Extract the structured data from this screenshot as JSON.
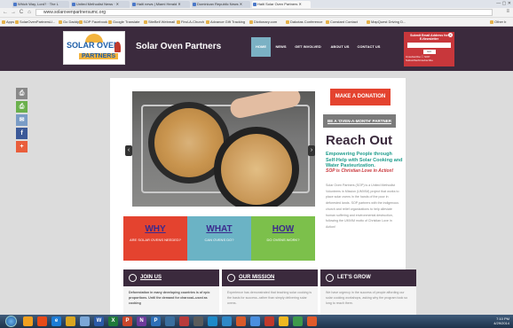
{
  "browser": {
    "tabs": [
      {
        "label": "Which Way, Lord? · The L"
      },
      {
        "label": "United Methodist News · ✕"
      },
      {
        "label": "Haiti news | Miami Herald ✕"
      },
      {
        "label": "Dominican Republic News ✕"
      },
      {
        "label": "Haiti Solar Oven Partners ✕"
      }
    ],
    "url": "www.solarovenpartnersumc.org",
    "bookmarks": [
      "Apps",
      "SolarOvenPartnersU...",
      "Go Daddy",
      "SOP Facebook",
      "Google Translate",
      "SiteBell Webmail",
      "Find-A-Church",
      "Advance Gift Tracking",
      "Dictionary.com",
      "Dakotas Conference",
      "Constant Contact",
      "MapQuest Driving D...",
      "Other b"
    ]
  },
  "site": {
    "logo": {
      "line1": "SOLAR OVEN",
      "line2": "PARTNERS"
    },
    "title": "Solar Oven Partners",
    "nav": [
      "HOME",
      "NEWS",
      "GET INVOLVED",
      "ABOUT US",
      "CONTACT US"
    ],
    "signup": {
      "line1": "Submit Email Address for",
      "line2": "E-Newsletter",
      "button": "GO",
      "sub": "Unsubscribe ☐  SOP Subscribe/Unsubscribe"
    }
  },
  "social": [
    "⎙",
    "⎙",
    "✉",
    "f",
    "+"
  ],
  "sidebar": {
    "donate": "MAKE A DONATION",
    "monthly": "BE A 'OVEN-A-MONTH' PARTNER",
    "heading": "Reach Out",
    "tagline": "Empowering People through Self-Help with Solar Cooking and Water Pasteurization.",
    "tagline2": "SOP is Christian Love in Action!",
    "body": "Solar Oven Partners (SOP) is a United Methodist Volunteers in Mission (UMVIM) project that works to place solar ovens in the hands of the poor in deforested lands. SOP partners with the indigenous church and relief organizations to help alleviate human suffering and environmental destruction, following the UMVIM motto of Christian Love in Action!"
  },
  "tiles": [
    {
      "big": "WHY",
      "small": "ARE SOLAR OVENS NEEDED?"
    },
    {
      "big": "WHAT",
      "small": "CAN OVENS DO?"
    },
    {
      "big": "HOW",
      "small": "DO OVENS WORK?"
    }
  ],
  "cards": [
    {
      "title": "JOIN US",
      "bold": "Deforestation in many developing countries is of epic proportions. Until the demand for charcoal--used as cooking",
      "text": ""
    },
    {
      "title": "OUR MISSION",
      "bold": "",
      "text": "Experience has demonstrated that teaching solar cooking is the basis for success--rather than simply delivering solar ovens."
    },
    {
      "title": "LET'S GROW",
      "bold": "",
      "text": "We have urgency in the success of people affording our solar cooking workshops, asking why the program took so long to reach them."
    }
  ],
  "taskbar": {
    "time": "7:10 PM",
    "date": "4/29/2014"
  },
  "colors": {
    "header": "#3b2a3d",
    "accent_red": "#e4432f",
    "teal": "#1e9c8c",
    "tile_red": "#e4432f",
    "tile_teal": "#6bb3c5",
    "tile_green": "#7cc04b"
  }
}
